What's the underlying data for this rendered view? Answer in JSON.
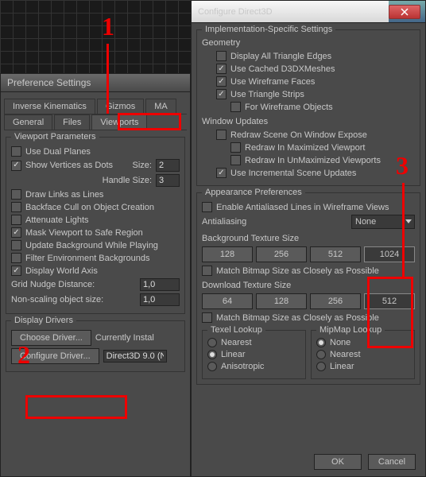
{
  "pref": {
    "title": "Preference Settings",
    "tabs1": [
      "Inverse Kinematics",
      "Gizmos",
      "MA"
    ],
    "tabs2": [
      "General",
      "Files",
      "Viewports"
    ],
    "viewport_params": {
      "title": "Viewport Parameters",
      "use_dual_planes": "Use Dual Planes",
      "show_vertices": "Show Vertices as Dots",
      "size_lbl": "Size:",
      "size_val": "2",
      "handle_lbl": "Handle Size:",
      "handle_val": "3",
      "draw_links": "Draw Links as Lines",
      "backface": "Backface Cull on Object Creation",
      "attenuate": "Attenuate Lights",
      "mask_vp": "Mask Viewport to Safe Region",
      "update_bg": "Update Background While Playing",
      "filter_env": "Filter Environment Backgrounds",
      "display_world": "Display World Axis",
      "grid_nudge_lbl": "Grid Nudge Distance:",
      "grid_nudge_val": "1,0",
      "nonscale_lbl": "Non-scaling object size:",
      "nonscale_val": "1,0"
    },
    "display_drivers": {
      "title": "Display Drivers",
      "choose": "Choose Driver...",
      "currently": "Currently Instal",
      "configure": "Configure Driver...",
      "current_val": "Direct3D 9.0 (N"
    }
  },
  "d3d": {
    "title": "Configure Direct3D",
    "impl": {
      "title": "Implementation-Specific Settings",
      "geometry": "Geometry",
      "display_edges": "Display All Triangle Edges",
      "use_cached": "Use Cached D3DXMeshes",
      "use_wireframe": "Use Wireframe Faces",
      "use_tristrips": "Use Triangle Strips",
      "for_wireframe": "For Wireframe Objects",
      "window_updates": "Window Updates",
      "redraw_expose": "Redraw Scene On Window Expose",
      "redraw_max": "Redraw In Maximized Viewport",
      "redraw_unmax": "Redraw In UnMaximized Viewports",
      "use_incremental": "Use Incremental Scene Updates"
    },
    "appearance": {
      "title": "Appearance Preferences",
      "enable_aa": "Enable Antialiased Lines in Wireframe Views",
      "aa_lbl": "Antialiasing",
      "aa_val": "None",
      "bg_tex": "Background Texture Size",
      "bg_sizes": [
        "128",
        "256",
        "512",
        "1024"
      ],
      "bg_active": 3,
      "match_bmp": "Match Bitmap Size as Closely as Possible",
      "dl_tex": "Download Texture Size",
      "dl_sizes": [
        "64",
        "128",
        "256",
        "512"
      ],
      "dl_active": 3,
      "texel": "Texel Lookup",
      "mipmap": "MipMap Lookup",
      "nearest": "Nearest",
      "linear": "Linear",
      "aniso": "Anisotropic",
      "none": "None"
    },
    "ok": "OK",
    "cancel": "Cancel"
  },
  "annotations": {
    "n1": "1",
    "n2": "2",
    "n3": "3"
  }
}
